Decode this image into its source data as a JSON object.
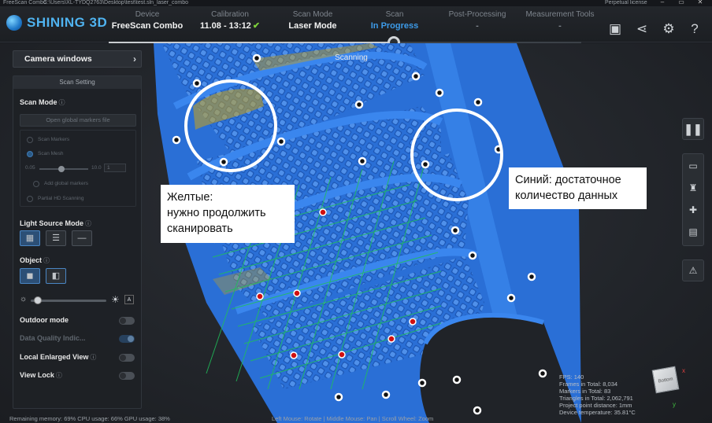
{
  "titlebar": {
    "app_name": "FreeScan Combo",
    "path": "C:\\Users\\XL-TYDQ2763\\Desktop\\test\\test.sln_laser_combo",
    "license": "Perpetual license"
  },
  "logo": {
    "text": "SHINING 3D"
  },
  "steps": [
    {
      "title": "Device",
      "value": "FreeScan Combo"
    },
    {
      "title": "Calibration",
      "value": "11.08 - 13:12"
    },
    {
      "title": "Scan Mode",
      "value": "Laser Mode"
    },
    {
      "title": "Scan",
      "value": "In Progress"
    },
    {
      "title": "Post-Processing",
      "value": "-"
    },
    {
      "title": "Measurement Tools",
      "value": "-"
    }
  ],
  "viewport": {
    "scanning_label": "Scanning",
    "callout_yellow": {
      "line1": "Желтые:",
      "line2": "нужно продолжить",
      "line3": "сканировать"
    },
    "callout_blue": {
      "line1": "Синий: достаточное",
      "line2": "количество данных"
    },
    "stats": {
      "fps": "FPS: 140",
      "frames": "Frames in Total: 8,034",
      "markers": "Markers in Total: 83",
      "triangles": "Triangles in Total: 2,062,791",
      "projection": "Project point distance: 1mm",
      "temperature": "Device temperature: 35.81°C"
    },
    "status_bottom": "Remaining memory: 69% CPU usage: 66% GPU usage: 38%",
    "status_mouse": "Left Mouse: Rotate | Middle Mouse: Pan | Scroll Wheel: Zoom",
    "cube_label": "Bottom",
    "axis_x": "x",
    "axis_y": "y"
  },
  "left_panel": {
    "camera_windows": "Camera windows",
    "scan_setting": "Scan Setting",
    "scan_mode": "Scan Mode",
    "open_global_markers": "Open global markers file",
    "scan_markers": "Scan Markers",
    "scan_mesh": "Scan Mesh",
    "res_min": "0.05",
    "res_max": "10.0",
    "res_value": "1",
    "add_global_markers": "Add global markers",
    "partial_hd": "Partial HD Scanning",
    "light_source_mode": "Light Source Mode",
    "object": "Object",
    "outdoor_mode": "Outdoor mode",
    "data_quality": "Data Quality Indic...",
    "local_enlarged": "Local Enlarged View",
    "view_lock": "View Lock"
  },
  "colors": {
    "scan_blue": "#2a6fd6",
    "accent": "#3d9be9",
    "yellow_data": "#c9a21a",
    "marker_red": "#d01010",
    "grid_green": "#1fbf5a"
  }
}
